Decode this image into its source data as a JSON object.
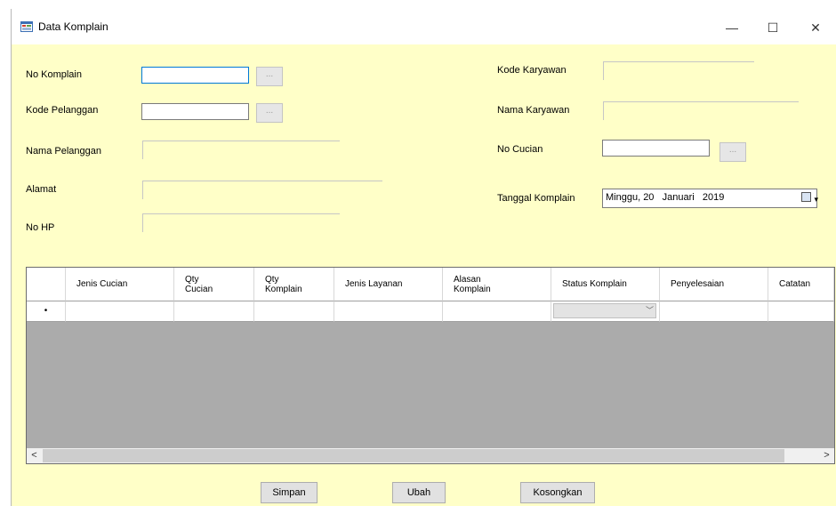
{
  "window": {
    "title": "Data Komplain",
    "controls": {
      "minimize": "—",
      "maximize": "☐",
      "close": "✕"
    }
  },
  "form": {
    "no_komplain": {
      "label": "No Komplain",
      "value": ""
    },
    "kode_pelanggan": {
      "label": "Kode Pelanggan",
      "value": ""
    },
    "nama_pelanggan": {
      "label": "Nama Pelanggan",
      "value": ""
    },
    "alamat": {
      "label": "Alamat",
      "value": ""
    },
    "no_hp": {
      "label": "No HP",
      "value": ""
    },
    "kode_karyawan": {
      "label": "Kode Karyawan",
      "value": ""
    },
    "nama_karyawan": {
      "label": "Nama Karyawan",
      "value": ""
    },
    "no_cucian": {
      "label": "No Cucian",
      "value": ""
    },
    "tanggal_komplain": {
      "label": "Tanggal Komplain",
      "value": "Minggu, 20   Januari   2019"
    },
    "browse_label": "..."
  },
  "grid": {
    "columns": [
      "Jenis Cucian",
      "Qty\nCucian",
      "Qty\nKomplain",
      "Jenis Layanan",
      "Alasan\nKomplain",
      "Status Komplain",
      "Penyelesaian",
      "Catatan"
    ],
    "new_row_marker": "•",
    "scroll_left": "<",
    "scroll_right": ">"
  },
  "buttons": {
    "simpan": "Simpan",
    "ubah": "Ubah",
    "kosongkan": "Kosongkan"
  },
  "colors": {
    "form_bg": "#ffffc8",
    "grid_bg": "#ababab",
    "focus_border": "#0078d7"
  }
}
